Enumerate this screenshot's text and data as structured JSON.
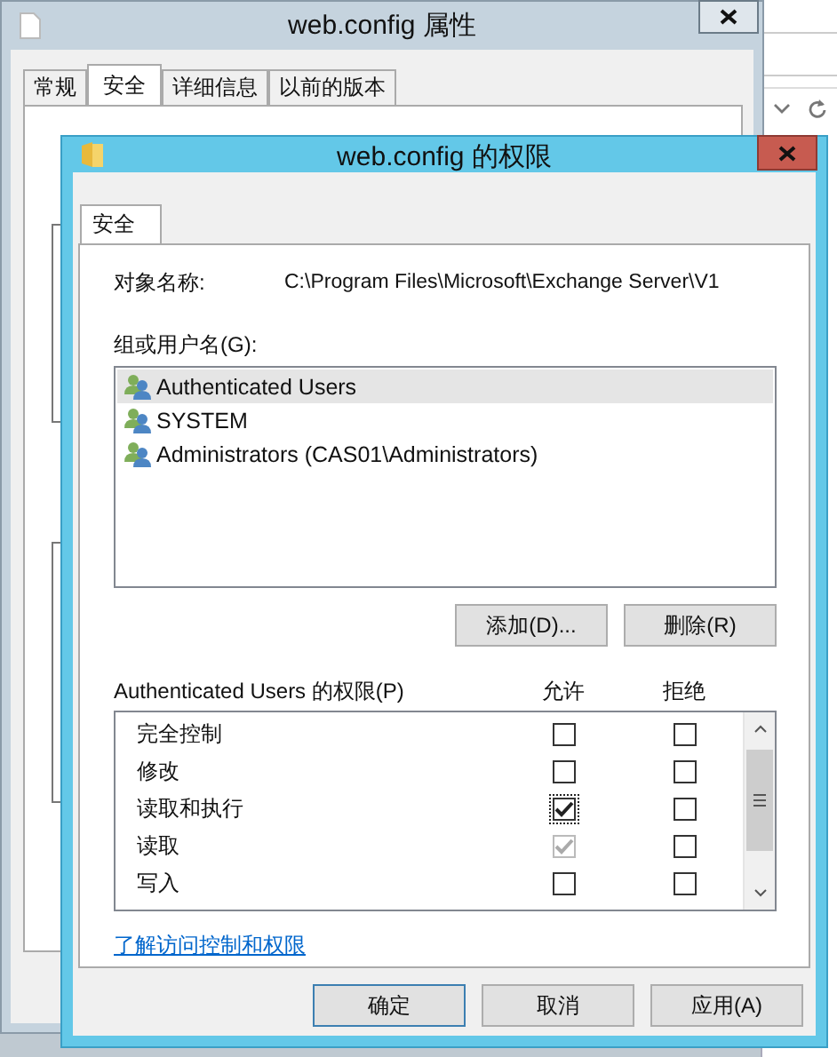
{
  "background_window": {
    "title": "web.config 属性",
    "tabs": [
      {
        "label": "常规",
        "selected": false
      },
      {
        "label": "安全",
        "selected": true
      },
      {
        "label": "详细信息",
        "selected": false
      },
      {
        "label": "以前的版本",
        "selected": false
      }
    ]
  },
  "dialog": {
    "title": "web.config 的权限",
    "tabs": [
      {
        "label": "安全",
        "selected": true
      }
    ],
    "object_name_label": "对象名称:",
    "object_name": "C:\\Program Files\\Microsoft\\Exchange Server\\V1",
    "groups_label": "组或用户名(G):",
    "groups": [
      {
        "name": "Authenticated Users",
        "selected": true
      },
      {
        "name": "SYSTEM",
        "selected": false
      },
      {
        "name": "Administrators (CAS01\\Administrators)",
        "selected": false
      }
    ],
    "group_buttons": [
      "添加(D)...",
      "删除(R)"
    ],
    "permissions_label": "Authenticated Users 的权限(P)",
    "allow_header": "允许",
    "deny_header": "拒绝",
    "permissions": [
      {
        "name": "完全控制",
        "allow": {
          "checked": false,
          "disabled": false,
          "focused": false
        },
        "deny": {
          "checked": false,
          "disabled": false,
          "focused": false
        }
      },
      {
        "name": "修改",
        "allow": {
          "checked": false,
          "disabled": false,
          "focused": false
        },
        "deny": {
          "checked": false,
          "disabled": false,
          "focused": false
        }
      },
      {
        "name": "读取和执行",
        "allow": {
          "checked": true,
          "disabled": false,
          "focused": true
        },
        "deny": {
          "checked": false,
          "disabled": false,
          "focused": false
        }
      },
      {
        "name": "读取",
        "allow": {
          "checked": true,
          "disabled": true,
          "focused": false
        },
        "deny": {
          "checked": false,
          "disabled": false,
          "focused": false
        }
      },
      {
        "name": "写入",
        "allow": {
          "checked": false,
          "disabled": false,
          "focused": false
        },
        "deny": {
          "checked": false,
          "disabled": false,
          "focused": false
        }
      }
    ],
    "link": "了解访问控制和权限",
    "footer_buttons": [
      {
        "label": "确定",
        "default": true
      },
      {
        "label": "取消",
        "default": false
      },
      {
        "label": "应用(A)",
        "default": false
      }
    ]
  }
}
